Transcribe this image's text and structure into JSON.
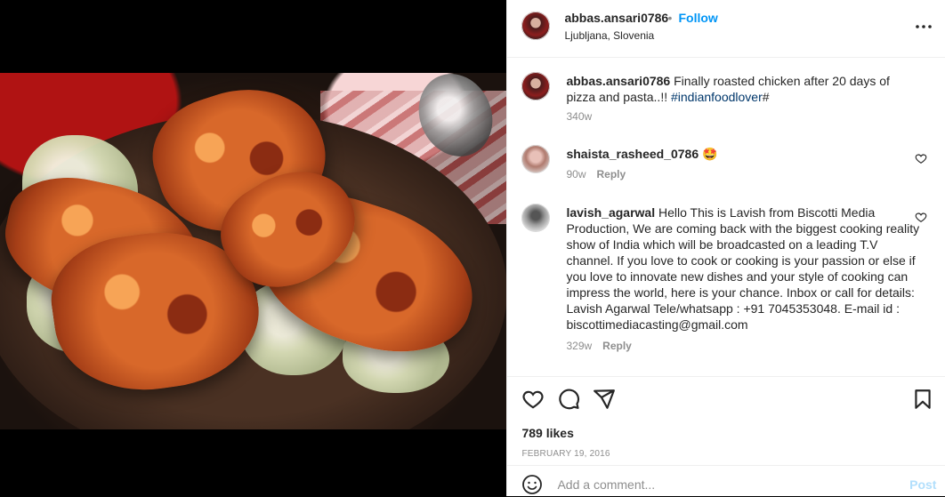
{
  "post": {
    "author": "abbas.ansari0786",
    "dot": "•",
    "follow_label": "Follow",
    "location": "Ljubljana, Slovenia",
    "more_icon": "more-dots-icon"
  },
  "caption": {
    "username": "abbas.ansari0786",
    "text": "Finally roasted chicken after 20 days of pizza and pasta..!!",
    "hashtag": "#indianfoodlover",
    "tail": "#",
    "time": "340w"
  },
  "comments": [
    {
      "username": "shaista_rasheed_0786",
      "text": "🤩",
      "time": "90w",
      "reply": "Reply"
    },
    {
      "username": "lavish_agarwal",
      "text": "Hello This is Lavish from Biscotti Media Production, We are coming back with the biggest cooking reality show of India which will be broadcasted on a leading T.V channel. If you love to cook or cooking is your passion or else if you love to innovate new dishes and your style of cooking can impress the world, here is your chance. Inbox or call for details: Lavish Agarwal Tele/whatsapp : +91 7045353048. E-mail id : biscottimediacasting@gmail.com",
      "time": "329w",
      "reply": "Reply"
    }
  ],
  "actions": {
    "icons": [
      "heart-icon",
      "comment-icon",
      "share-icon",
      "bookmark-icon"
    ]
  },
  "likes": "789 likes",
  "date": "FEBRUARY 19, 2016",
  "comment_box": {
    "placeholder": "Add a comment...",
    "post_label": "Post"
  },
  "colors": {
    "accent": "#0095f6",
    "post_disabled": "#b2dffc",
    "text": "#262626",
    "muted": "#8e8e8e"
  }
}
